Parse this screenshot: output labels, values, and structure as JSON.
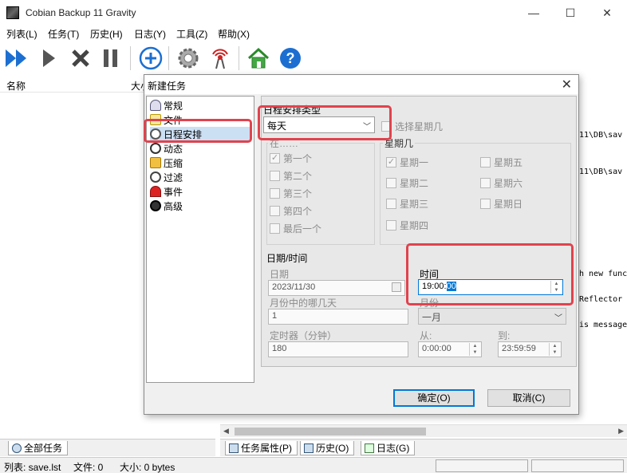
{
  "window": {
    "title": "Cobian Backup 11 Gravity",
    "minimize": "—",
    "maximize": "☐",
    "close": "✕"
  },
  "menu": [
    "列表(L)",
    "任务(T)",
    "历史(H)",
    "日志(Y)",
    "工具(Z)",
    "帮助(X)"
  ],
  "left_panel": {
    "col_name": "名称",
    "col_size": "大小"
  },
  "log_lines": [
    "11\\DB\\sav",
    "11\\DB\\sav",
    "h new func",
    "Reflector",
    "is message"
  ],
  "bottom_tabs": {
    "all_tasks": "全部任务",
    "task_props": "任务属性(P)",
    "history": "历史(O)",
    "log": "日志(G)"
  },
  "status": {
    "list": "列表: save.lst",
    "files": "文件: 0",
    "size": "大小: 0 bytes"
  },
  "dialog": {
    "title": "新建任务",
    "close": "✕",
    "tree": [
      "常规",
      "文件",
      "日程安排",
      "动态",
      "压缩",
      "过滤",
      "事件",
      "高级"
    ],
    "selected_tree_item": "日程安排",
    "schedule_type_label": "日程安排类型",
    "schedule_type_value": "每天",
    "choose_weekday_label": "选择星期几",
    "on_group_label": "在……",
    "on_options": [
      {
        "label": "第一个",
        "checked": true
      },
      {
        "label": "第二个",
        "checked": false
      },
      {
        "label": "第三个",
        "checked": false
      },
      {
        "label": "第四个",
        "checked": false
      },
      {
        "label": "最后一个",
        "checked": false
      }
    ],
    "weekday_group_label": "星期几",
    "weekdays_left": [
      {
        "label": "星期一",
        "checked": true
      },
      {
        "label": "星期二",
        "checked": false
      },
      {
        "label": "星期三",
        "checked": false
      },
      {
        "label": "星期四",
        "checked": false
      }
    ],
    "weekdays_right": [
      {
        "label": "星期五",
        "checked": false
      },
      {
        "label": "星期六",
        "checked": false
      },
      {
        "label": "星期日",
        "checked": false
      }
    ],
    "datetime_group_label": "日期/时间",
    "date_label": "日期",
    "date_value": "2023/11/30",
    "time_label": "时间",
    "time_value_prefix": "19:00:",
    "time_value_selected": "00",
    "day_of_month_label": "月份中的哪几天",
    "day_of_month_value": "1",
    "month_label": "月份",
    "month_value": "一月",
    "timer_label": "定时器（分钟）",
    "timer_value": "180",
    "from_label": "从:",
    "from_value": "0:00:00",
    "to_label": "到:",
    "to_value": "23:59:59",
    "ok": "确定(O)",
    "cancel": "取消(C)"
  },
  "colors": {
    "highlight": "#e0434e",
    "accent": "#0078d7",
    "selection": "#0078d7"
  }
}
